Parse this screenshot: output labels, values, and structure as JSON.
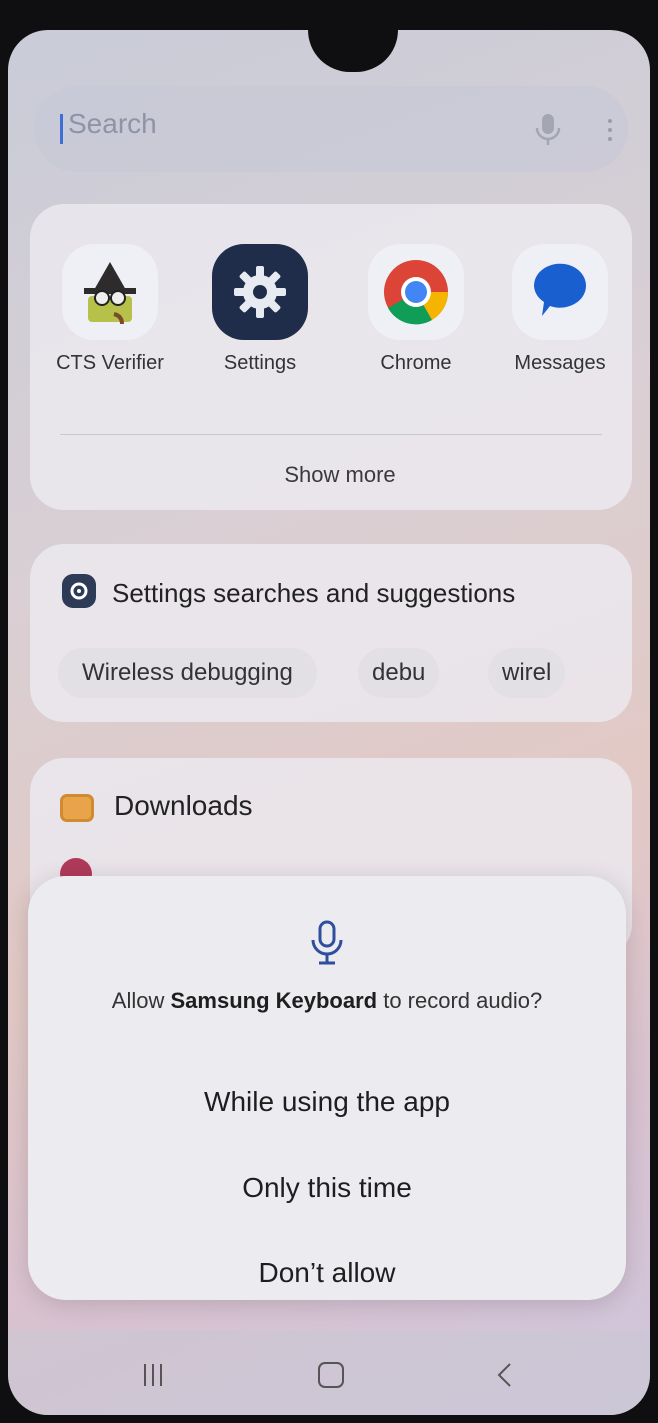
{
  "search": {
    "placeholder": "Search"
  },
  "apps": [
    {
      "label": "CTS Verifier",
      "icon": "cts-verifier-icon"
    },
    {
      "label": "Settings",
      "icon": "settings-gear-icon"
    },
    {
      "label": "Chrome",
      "icon": "chrome-icon"
    },
    {
      "label": "Messages",
      "icon": "messages-icon"
    }
  ],
  "show_more": "Show more",
  "settings_section": {
    "title": "Settings searches and suggestions",
    "chips": [
      "Wireless debugging",
      "debu",
      "wirel"
    ]
  },
  "downloads": {
    "label": "Downloads"
  },
  "dialog": {
    "prefix": "Allow ",
    "app_name": "Samsung Keyboard",
    "suffix": " to record audio?",
    "buttons": [
      "While using the app",
      "Only this time",
      "Don’t allow"
    ]
  },
  "colors": {
    "accent": "#3d6fd6",
    "settings_icon_bg": "#2d3b57"
  }
}
